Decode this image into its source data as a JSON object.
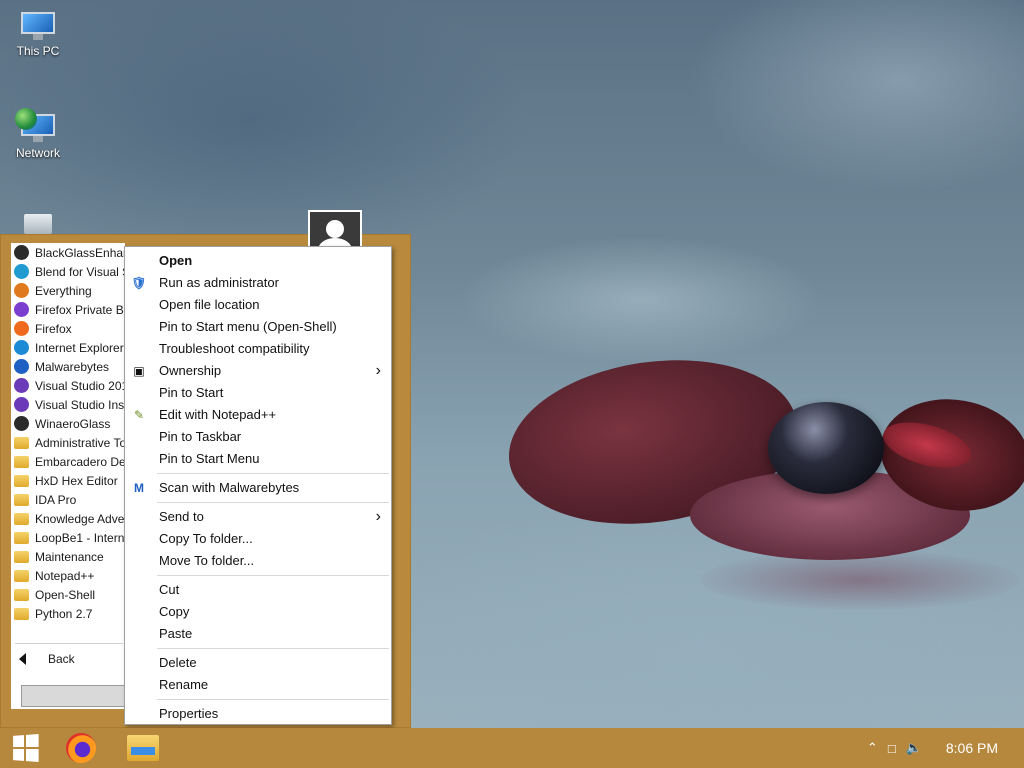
{
  "desktop": {
    "icons": [
      {
        "label": "This PC",
        "icon": "computer-icon"
      },
      {
        "label": "Network",
        "icon": "network-icon"
      }
    ]
  },
  "start_menu": {
    "programs": [
      {
        "label": "BlackGlassEnhance",
        "icon": "app-icon"
      },
      {
        "label": "Blend for Visual St",
        "icon": "blend-icon"
      },
      {
        "label": "Everything",
        "icon": "search-icon"
      },
      {
        "label": "Firefox Private Bro",
        "icon": "firefox-private-icon"
      },
      {
        "label": "Firefox",
        "icon": "firefox-icon"
      },
      {
        "label": "Internet Explorer",
        "icon": "ie-icon"
      },
      {
        "label": "Malwarebytes",
        "icon": "malwarebytes-icon"
      },
      {
        "label": "Visual Studio 2017",
        "icon": "visual-studio-icon"
      },
      {
        "label": "Visual Studio Insta",
        "icon": "visual-studio-icon"
      },
      {
        "label": "WinaeroGlass",
        "icon": "app-icon"
      },
      {
        "label": "Administrative Too",
        "icon": "folder-icon"
      },
      {
        "label": "Embarcadero Dev",
        "icon": "folder-icon"
      },
      {
        "label": "HxD Hex Editor",
        "icon": "folder-icon"
      },
      {
        "label": "IDA Pro",
        "icon": "folder-icon"
      },
      {
        "label": "Knowledge Adven",
        "icon": "folder-icon"
      },
      {
        "label": "LoopBe1 - Internal",
        "icon": "folder-icon"
      },
      {
        "label": "Maintenance",
        "icon": "folder-icon"
      },
      {
        "label": "Notepad++",
        "icon": "folder-icon"
      },
      {
        "label": "Open-Shell",
        "icon": "folder-icon"
      },
      {
        "label": "Python 2.7",
        "icon": "folder-icon"
      }
    ],
    "back_label": "Back"
  },
  "context_menu": {
    "groups": [
      [
        {
          "label": "Open",
          "bold": true
        },
        {
          "label": "Run as administrator",
          "icon": "shield-icon"
        },
        {
          "label": "Open file location"
        },
        {
          "label": "Pin to Start menu (Open-Shell)"
        },
        {
          "label": "Troubleshoot compatibility"
        },
        {
          "label": "Ownership",
          "icon": "cmd-icon",
          "submenu": true
        },
        {
          "label": "Pin to Start"
        },
        {
          "label": "Edit with Notepad++",
          "icon": "notepad-icon"
        },
        {
          "label": "Pin to Taskbar"
        },
        {
          "label": "Pin to Start Menu"
        }
      ],
      [
        {
          "label": "Scan with Malwarebytes",
          "icon": "malwarebytes-icon"
        }
      ],
      [
        {
          "label": "Send to",
          "submenu": true
        },
        {
          "label": "Copy To folder..."
        },
        {
          "label": "Move To folder..."
        }
      ],
      [
        {
          "label": "Cut"
        },
        {
          "label": "Copy"
        },
        {
          "label": "Paste"
        }
      ],
      [
        {
          "label": "Delete"
        },
        {
          "label": "Rename"
        }
      ],
      [
        {
          "label": "Properties"
        }
      ]
    ]
  },
  "taskbar": {
    "clock": "8:06 PM"
  },
  "colors": {
    "taskbar": "#b6883d",
    "start_menu": "#b98a3e"
  }
}
